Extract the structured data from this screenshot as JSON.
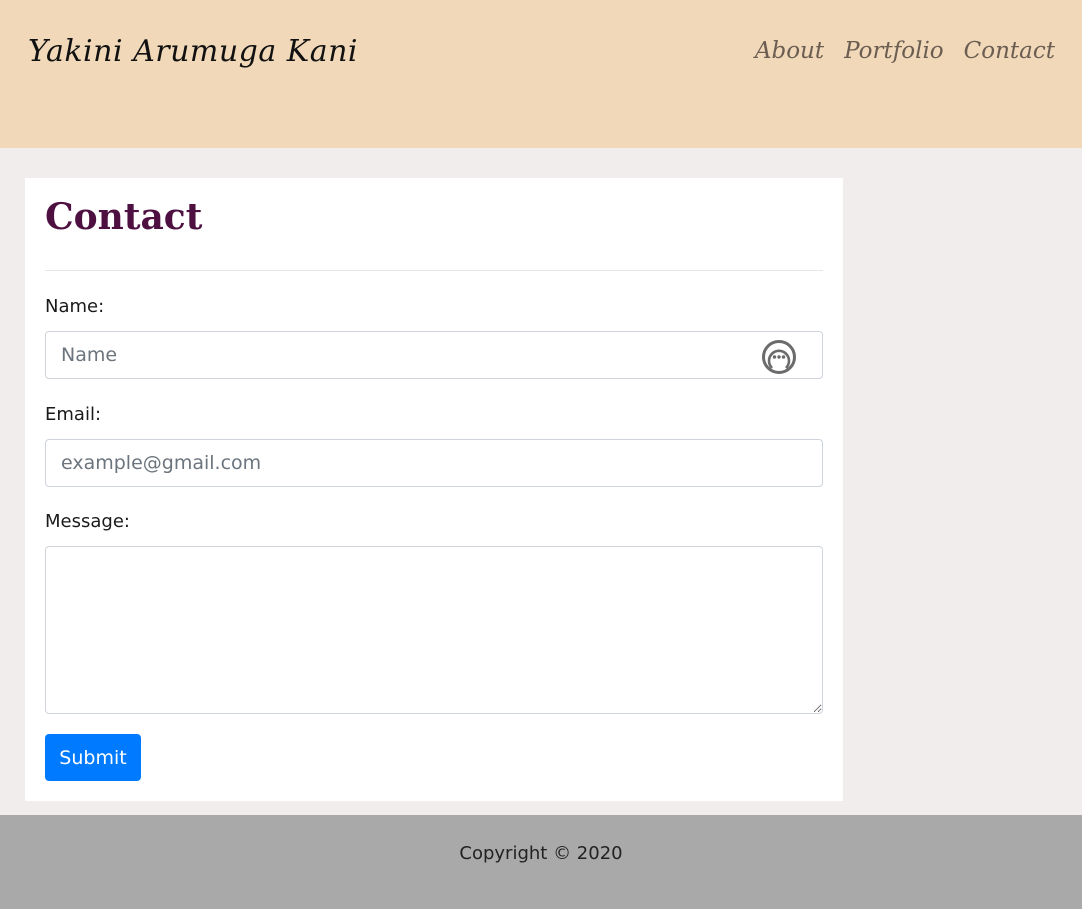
{
  "header": {
    "brand": "Yakini Arumuga Kani",
    "nav": [
      "About",
      "Portfolio",
      "Contact"
    ],
    "background_color": "#f0d8b8"
  },
  "contact": {
    "title": "Contact",
    "name_label": "Name:",
    "name_placeholder": "Name",
    "name_value": "",
    "email_label": "Email:",
    "email_placeholder": "example@gmail.com",
    "email_value": "",
    "message_label": "Message:",
    "message_value": "",
    "submit_label": "Submit",
    "title_color": "#4d1040",
    "accent_color": "#007bff",
    "field_icon": "chat-bubble-icon"
  },
  "footer": {
    "copyright": "Copyright © 2020",
    "background_color": "#a9a9a9"
  },
  "page": {
    "background_color": "#f2eded"
  }
}
